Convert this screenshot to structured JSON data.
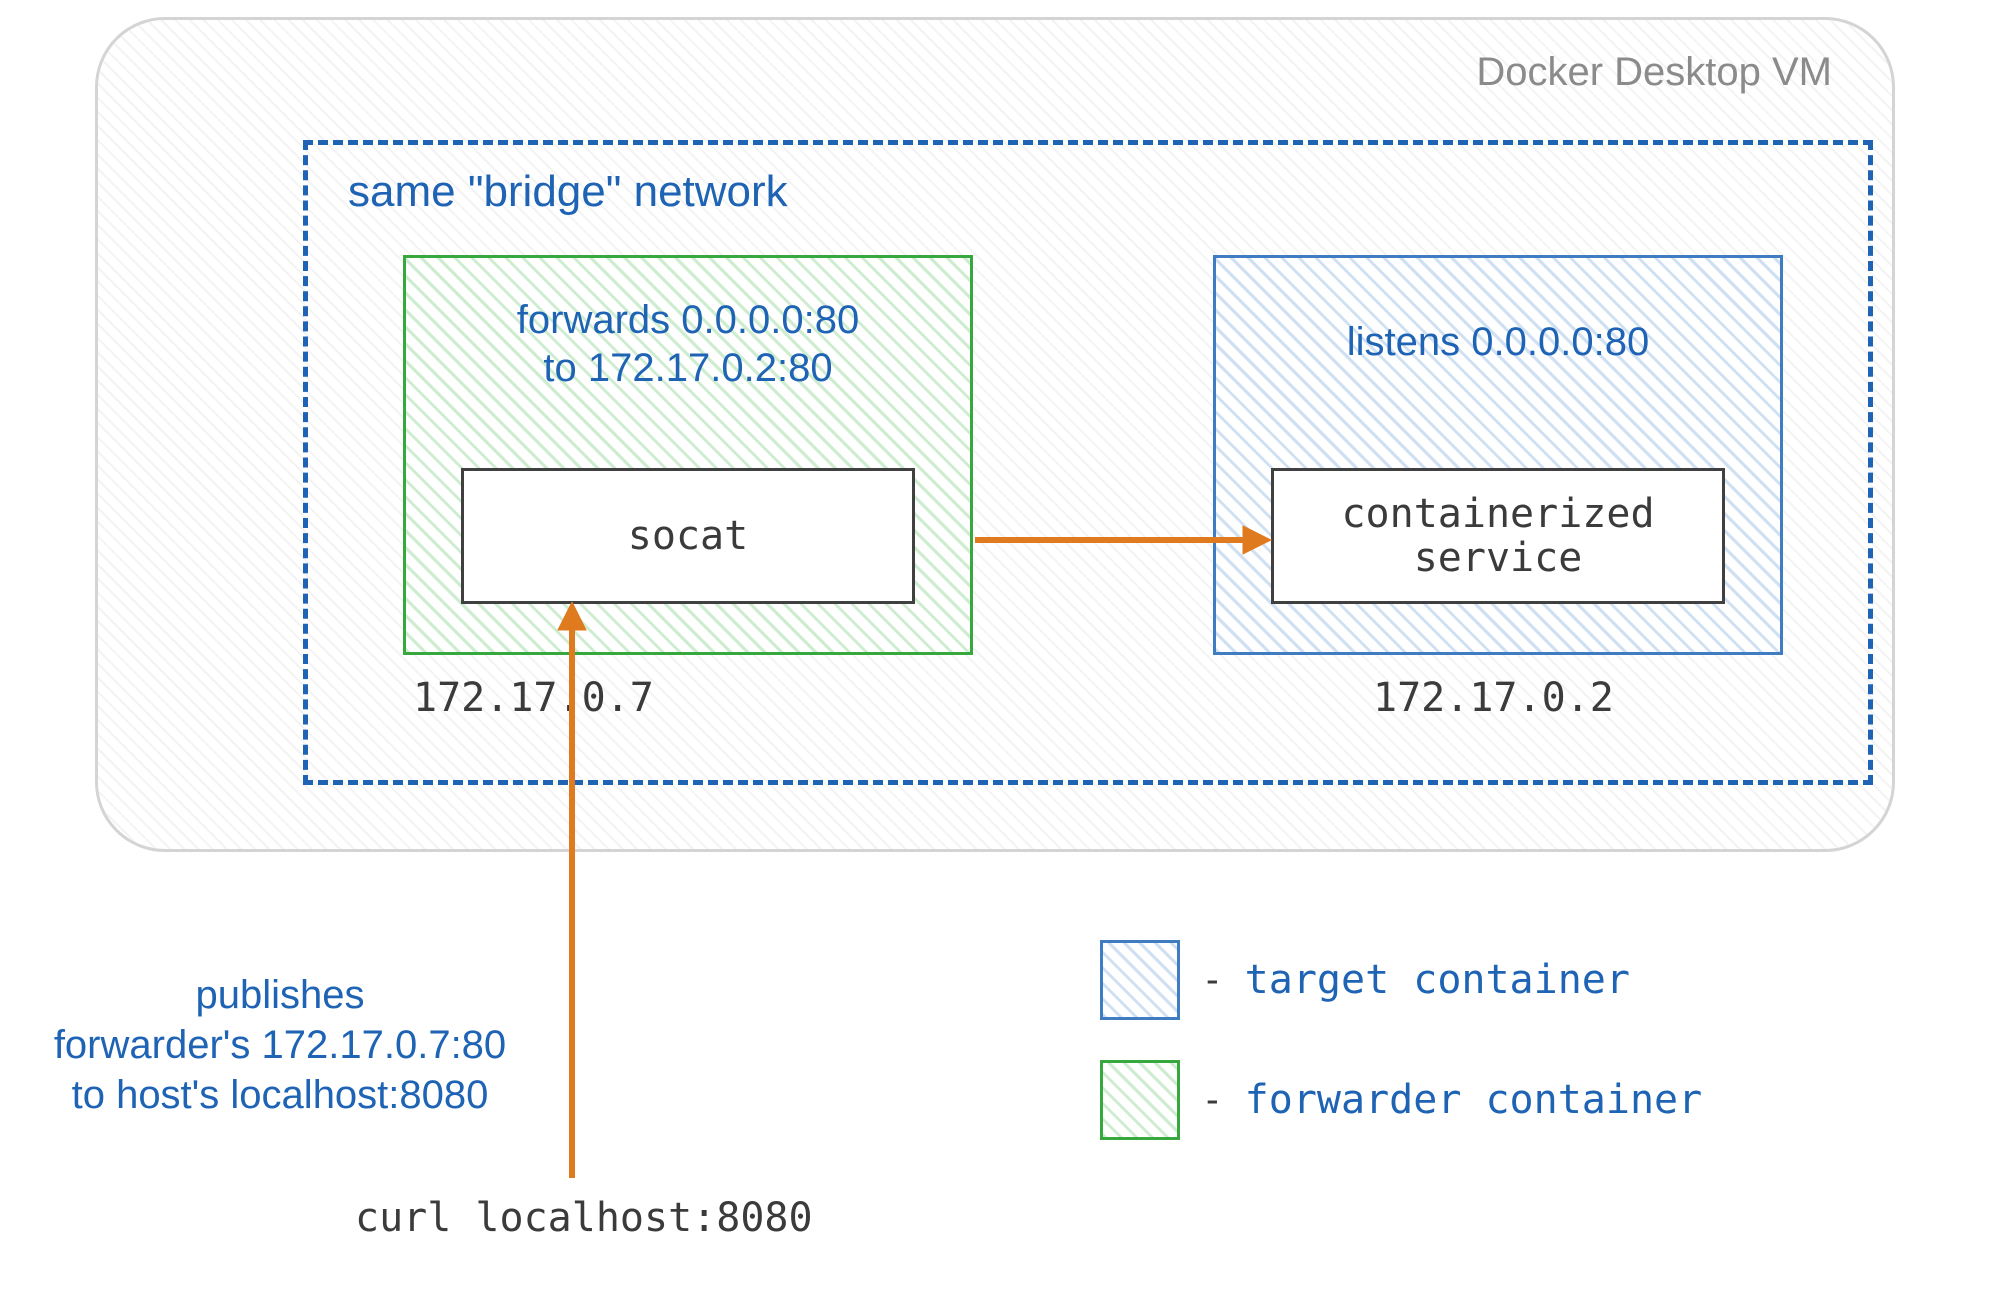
{
  "vm_title": "Docker Desktop VM",
  "bridge_title": "same \"bridge\" network",
  "forwarder": {
    "desc_line1": "forwards 0.0.0.0:80",
    "desc_line2": "to 172.17.0.2:80",
    "label": "socat",
    "ip": "172.17.0.7"
  },
  "target": {
    "desc_line1": "listens 0.0.0.0:80",
    "label": "containerized\nservice",
    "ip": "172.17.0.2"
  },
  "publish": {
    "line1": "publishes",
    "line2": "forwarder's 172.17.0.7:80",
    "line3": "to host's localhost:8080"
  },
  "curl_cmd": "curl localhost:8080",
  "legend": {
    "target": "target container",
    "forwarder": "forwarder container"
  },
  "colors": {
    "blue": "#1e63b4",
    "green": "#36a83e",
    "orange": "#e07a1f",
    "grey": "#8b8b8b"
  }
}
